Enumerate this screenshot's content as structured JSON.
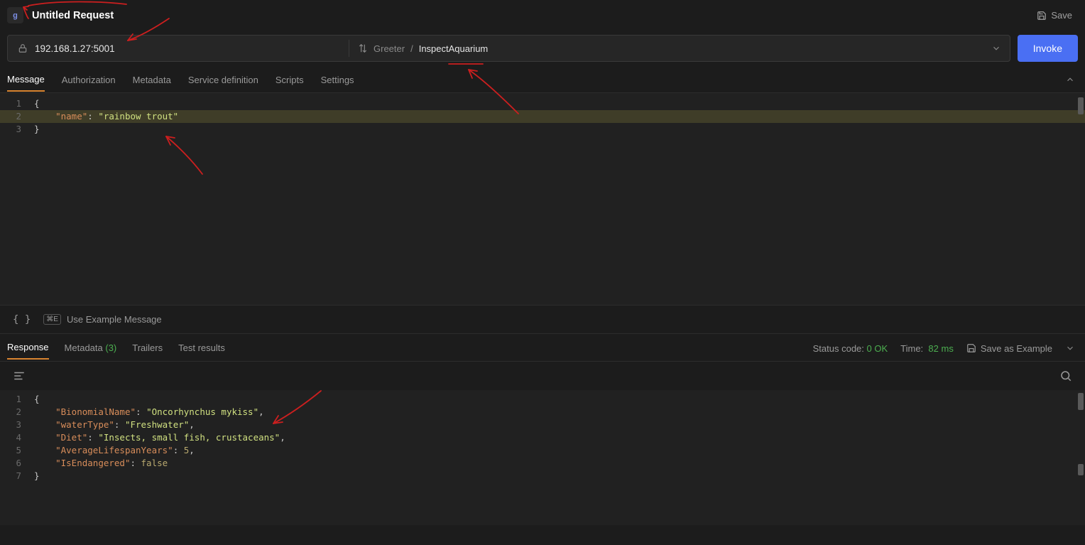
{
  "header": {
    "badge": "g",
    "title": "Untitled Request",
    "save_label": "Save"
  },
  "urlbar": {
    "endpoint": "192.168.1.27:5001",
    "service": "Greeter",
    "sep": " / ",
    "method": "InspectAquarium"
  },
  "invoke_label": "Invoke",
  "request_tabs": [
    "Message",
    "Authorization",
    "Metadata",
    "Service definition",
    "Scripts",
    "Settings"
  ],
  "request_active_tab": 0,
  "request_body": {
    "lines": [
      {
        "n": "1",
        "tokens": [
          {
            "t": "brace",
            "v": "{"
          }
        ]
      },
      {
        "n": "2",
        "highlight": true,
        "tokens": [
          {
            "t": "indent",
            "v": "    "
          },
          {
            "t": "key",
            "v": "\"name\""
          },
          {
            "t": "punct",
            "v": ": "
          },
          {
            "t": "str",
            "v": "\"rainbow trout\""
          }
        ]
      },
      {
        "n": "3",
        "tokens": [
          {
            "t": "brace",
            "v": "}"
          }
        ]
      }
    ]
  },
  "editor_footer": {
    "example_label": "Use Example Message"
  },
  "response_tabs": [
    {
      "label": "Response"
    },
    {
      "label": "Metadata",
      "count": "(3)"
    },
    {
      "label": "Trailers"
    },
    {
      "label": "Test results"
    }
  ],
  "response_active_tab": 0,
  "response_status": {
    "status_label": "Status code:",
    "status_value": "0 OK",
    "time_label": "Time:",
    "time_value": "82 ms",
    "save_example_label": "Save as Example"
  },
  "response_body": {
    "lines": [
      {
        "n": "1",
        "tokens": [
          {
            "t": "brace",
            "v": "{"
          }
        ]
      },
      {
        "n": "2",
        "tokens": [
          {
            "t": "indent",
            "v": "    "
          },
          {
            "t": "key",
            "v": "\"BionomialName\""
          },
          {
            "t": "punct",
            "v": ": "
          },
          {
            "t": "str",
            "v": "\"Oncorhynchus mykiss\""
          },
          {
            "t": "punct",
            "v": ","
          }
        ]
      },
      {
        "n": "3",
        "tokens": [
          {
            "t": "indent",
            "v": "    "
          },
          {
            "t": "key",
            "v": "\"waterType\""
          },
          {
            "t": "punct",
            "v": ": "
          },
          {
            "t": "str",
            "v": "\"Freshwater\""
          },
          {
            "t": "punct",
            "v": ","
          }
        ]
      },
      {
        "n": "4",
        "tokens": [
          {
            "t": "indent",
            "v": "    "
          },
          {
            "t": "key",
            "v": "\"Diet\""
          },
          {
            "t": "punct",
            "v": ": "
          },
          {
            "t": "str",
            "v": "\"Insects, small fish, crustaceans\""
          },
          {
            "t": "punct",
            "v": ","
          }
        ]
      },
      {
        "n": "5",
        "tokens": [
          {
            "t": "indent",
            "v": "    "
          },
          {
            "t": "key",
            "v": "\"AverageLifespanYears\""
          },
          {
            "t": "punct",
            "v": ": "
          },
          {
            "t": "num",
            "v": "5"
          },
          {
            "t": "punct",
            "v": ","
          }
        ]
      },
      {
        "n": "6",
        "tokens": [
          {
            "t": "indent",
            "v": "    "
          },
          {
            "t": "key",
            "v": "\"IsEndangered\""
          },
          {
            "t": "punct",
            "v": ": "
          },
          {
            "t": "bool",
            "v": "false"
          }
        ]
      },
      {
        "n": "7",
        "tokens": [
          {
            "t": "brace",
            "v": "}"
          }
        ]
      }
    ]
  }
}
